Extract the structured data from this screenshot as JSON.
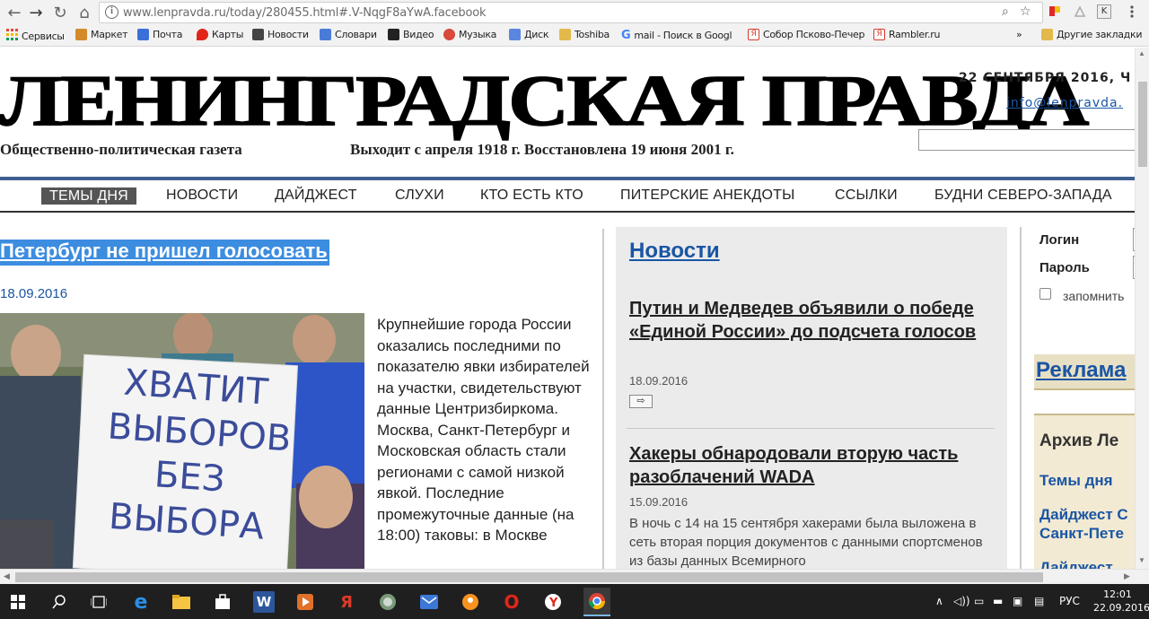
{
  "browser": {
    "url": "www.lenpravda.ru/today/280455.html#.V-NqgF8aYwA.facebook",
    "back_icon": "←",
    "forward_icon": "→",
    "reload_icon": "↻",
    "home_icon": "⌂",
    "zoom_icon": "⌕",
    "star_icon": "☆",
    "ext_k": "K"
  },
  "bookmarks": {
    "items": [
      {
        "label": "Сервисы",
        "color": "#e8443a"
      },
      {
        "label": "Маркет",
        "color": "#d48a2a"
      },
      {
        "label": "Почта",
        "color": "#3b6fd8"
      },
      {
        "label": "Карты",
        "color": "#e0261a"
      },
      {
        "label": "Новости",
        "color": "#444444"
      },
      {
        "label": "Словари",
        "color": "#4a7bd8"
      },
      {
        "label": "Видео",
        "color": "#222222"
      },
      {
        "label": "Музыка",
        "color": "#d84a3a"
      },
      {
        "label": "Диск",
        "color": "#5b86e0"
      },
      {
        "label": "Toshiba",
        "color": "#e2b94a"
      },
      {
        "label": "mail - Поиск в Googl",
        "color": "#4285f4"
      },
      {
        "label": "Собор Псково-Печер",
        "color": "#d83a2a"
      },
      {
        "label": "Rambler.ru",
        "color": "#d83a2a"
      }
    ],
    "more": "»",
    "other": "Другие закладки"
  },
  "site": {
    "masthead": "ЛЕНИНГРАДСКАЯ ПРАВДА",
    "subtitle": "Общественно-политическая газета",
    "since": "Выходит с апреля 1918 г.   Восстановлена 19 июня 2001 г.",
    "date": "22 СЕНТЯБРЯ 2016, Ч",
    "email": "info@lenpravda."
  },
  "nav": [
    "ТЕМЫ ДНЯ",
    "НОВОСТИ",
    "ДАЙДЖЕСТ",
    "СЛУХИ",
    "КТО ЕСТЬ КТО",
    "ПИТЕРСКИЕ АНЕКДОТЫ",
    "ССЫЛКИ",
    "БУДНИ СЕВЕРО-ЗАПАДА"
  ],
  "article": {
    "title": "Петербург не пришел голосовать",
    "date": "18.09.2016",
    "photo_sign": [
      "ХВАТИТ",
      "ВЫБОРОВ",
      "БЕЗ ВЫБОРА"
    ],
    "body": "Крупнейшие города России оказались последними по показателю явки избирателей на участки, свидетельствуют данные Центризбиркома. Москва, Санкт-Петербург и Московская область стали регионами с самой низкой явкой. Последние промежуточные данные (на 18:00) таковы: в Москве"
  },
  "news": {
    "heading": "Новости",
    "items": [
      {
        "title": "Путин и Медведев объявили о победе «Единой России» до подсчета голосов",
        "date": "18.09.2016",
        "more_icon": "⇨"
      },
      {
        "title": "Хакеры обнародовали вторую часть разоблачений WADA",
        "date": "15.09.2016",
        "text": "В ночь с 14 на 15 сентября хакерами была выложена в сеть вторая порция документов с данными спортсменов из базы данных Всемирного"
      }
    ]
  },
  "sidebar": {
    "login_label": "Логин",
    "password_label": "Пароль",
    "remember_label": "запомнить",
    "ads": "Реклама",
    "archive_heading": "Архив Ле",
    "archive_items": [
      "Темы дня",
      "Дайджест С",
      "Санкт-Пете",
      "Дайджест"
    ]
  },
  "taskbar": {
    "lang": "РУС",
    "time": "12:01",
    "date": "22.09.2016",
    "tray_up": "∧"
  }
}
